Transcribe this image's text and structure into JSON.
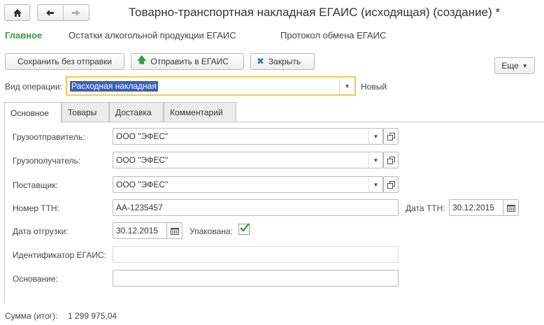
{
  "window": {
    "title": "Товарно-транспортная накладная ЕГАИС (исходящая) (создание) *"
  },
  "nav": {
    "home_icon": "home-icon",
    "back_icon": "arrow-left-icon",
    "forward_icon": "arrow-right-icon"
  },
  "sections": [
    {
      "label": "Главное"
    },
    {
      "label": "Остатки алкогольной продукции ЕГАИС"
    },
    {
      "label": "Протокол обмена ЕГАИС"
    }
  ],
  "toolbar": {
    "save_label": "Сохранить без отправки",
    "send_label": "Отправить в ЕГАИС",
    "close_label": "Закрыть",
    "more_label": "Еще"
  },
  "operation": {
    "label": "Вид операции:",
    "value": "Расходная накладная",
    "status": "Новый"
  },
  "tabs": [
    {
      "label": "Основное"
    },
    {
      "label": "Товары"
    },
    {
      "label": "Доставка"
    },
    {
      "label": "Комментарий"
    }
  ],
  "form": {
    "shipper": {
      "label": "Грузоотправитель:",
      "value": "ООО \"ЭФЕС\""
    },
    "consignee": {
      "label": "Грузополучатель:",
      "value": "ООО \"ЭФЕС\""
    },
    "supplier": {
      "label": "Поставщик:",
      "value": "ООО \"ЭФЕС\""
    },
    "ttn_number": {
      "label": "Номер ТТН:",
      "value": "АА-1235457"
    },
    "ttn_date": {
      "label": "Дата ТТН:",
      "value": "30.12.2015"
    },
    "ship_date": {
      "label": "Дата отгрузки:",
      "value": "30.12.2015"
    },
    "packed": {
      "label": "Упакована:",
      "checked": true
    },
    "egais_id": {
      "label": "Идентификатор ЕГАИС:",
      "value": ""
    },
    "basis": {
      "label": "Основание:",
      "value": ""
    }
  },
  "footer": {
    "total_label": "Сумма (итог):",
    "total_value": "1 299 975,04"
  },
  "colors": {
    "accent_green": "#3c9a3c",
    "focus_yellow": "#f2c94c",
    "selection_blue": "#3a60b6"
  }
}
